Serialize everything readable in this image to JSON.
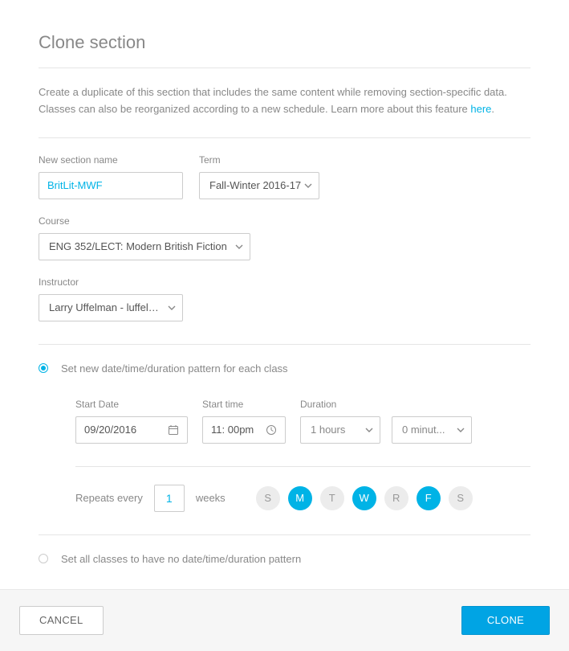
{
  "title": "Clone section",
  "description": {
    "text": "Create a duplicate of this section that includes the same content while removing section-specific data. Classes can also be reorganized according to a new schedule. Learn more about this feature ",
    "link_label": "here"
  },
  "form": {
    "new_section_name": {
      "label": "New section name",
      "value": "BritLit-MWF"
    },
    "term": {
      "label": "Term",
      "value": "Fall-Winter 2016-17"
    },
    "course": {
      "label": "Course",
      "value": "ENG 352/LECT: Modern British Fiction"
    },
    "instructor": {
      "label": "Instructor",
      "value": "Larry Uffelman - luffelma..."
    }
  },
  "options": {
    "set_pattern": {
      "label": "Set new date/time/duration pattern for each class",
      "selected": true
    },
    "no_pattern": {
      "label": "Set all classes to have no date/time/duration pattern",
      "selected": false
    }
  },
  "schedule": {
    "start_date": {
      "label": "Start Date",
      "value": "09/20/2016"
    },
    "start_time": {
      "label": "Start time",
      "hour": "11",
      "minute": "00",
      "ampm": "pm"
    },
    "duration": {
      "label": "Duration",
      "hours": "1 hours",
      "minutes": "0 minut..."
    },
    "repeats": {
      "prefix": "Repeats every",
      "value": "1",
      "suffix": "weeks"
    },
    "days": [
      {
        "label": "S",
        "on": false
      },
      {
        "label": "M",
        "on": true
      },
      {
        "label": "T",
        "on": false
      },
      {
        "label": "W",
        "on": true
      },
      {
        "label": "R",
        "on": false
      },
      {
        "label": "F",
        "on": true
      },
      {
        "label": "S",
        "on": false
      }
    ]
  },
  "footer": {
    "cancel": "CANCEL",
    "clone": "CLONE"
  }
}
